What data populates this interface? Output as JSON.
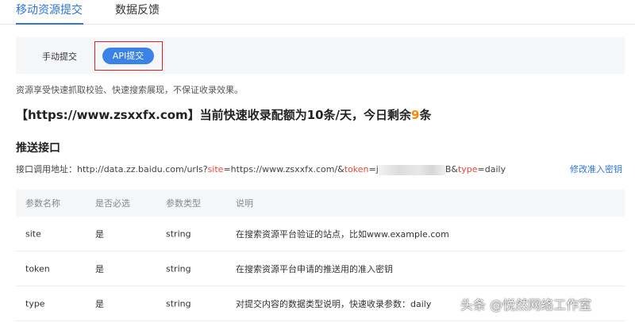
{
  "top_tabs": {
    "active_label": "移动资源提交",
    "inactive_label": "数据反馈"
  },
  "sub_tabs": {
    "manual_label": "手动提交",
    "api_label": "API提交"
  },
  "notice": "资源享受快速抓取校验、快速搜索展现，不保证收录效果。",
  "quota": {
    "prefix": "【https://www.zsxxfx.com】当前快速收录配额为10条/天，今日剩余",
    "remaining": "9",
    "suffix": "条"
  },
  "section_title": "推送接口",
  "url": {
    "prefix": "接口调用地址：http://data.zz.baidu.com/urls?",
    "param_site": "site",
    "site_value": "=https://www.zsxxfx.com/&",
    "param_token": "token",
    "token_value_start": "=j",
    "token_value_end": "B&",
    "param_type": "type",
    "type_value": "=daily"
  },
  "modify_link": "修改准入密钥",
  "table": {
    "headers": [
      "参数名称",
      "是否必选",
      "参数类型",
      "说明"
    ],
    "rows": [
      [
        "site",
        "是",
        "string",
        "在搜索资源平台验证的站点，比如www.example.com"
      ],
      [
        "token",
        "是",
        "string",
        "在搜索资源平台申请的推送用的准入密钥"
      ],
      [
        "type",
        "是",
        "string",
        "对提交内容的数据类型说明，快速收录参数：daily"
      ]
    ]
  },
  "watermark": "头条 @悦然网络工作室",
  "colors": {
    "accent": "#2f74d6",
    "highlight_box": "#e02020",
    "param_red": "#e24a3d",
    "orange": "#f5880a"
  }
}
